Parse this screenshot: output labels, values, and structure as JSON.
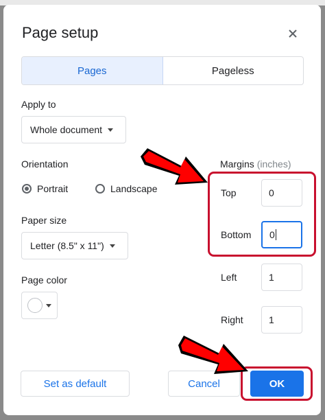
{
  "dialog": {
    "title": "Page setup",
    "close_icon": "close-icon"
  },
  "tabs": [
    {
      "label": "Pages",
      "active": true
    },
    {
      "label": "Pageless",
      "active": false
    }
  ],
  "apply_to": {
    "label": "Apply to",
    "value": "Whole document"
  },
  "orientation": {
    "label": "Orientation",
    "options": [
      {
        "label": "Portrait",
        "selected": true
      },
      {
        "label": "Landscape",
        "selected": false
      }
    ]
  },
  "paper_size": {
    "label": "Paper size",
    "value": "Letter (8.5\" x 11\")"
  },
  "page_color": {
    "label": "Page color",
    "value": "#ffffff"
  },
  "margins": {
    "label": "Margins",
    "unit": "(inches)",
    "top_label": "Top",
    "top_value": "0",
    "bottom_label": "Bottom",
    "bottom_value": "0",
    "left_label": "Left",
    "left_value": "1",
    "right_label": "Right",
    "right_value": "1"
  },
  "buttons": {
    "set_default": "Set as default",
    "cancel": "Cancel",
    "ok": "OK"
  },
  "colors": {
    "accent": "#1a73e8",
    "annotation": "#ff0000",
    "highlight_border": "#c8102e"
  }
}
